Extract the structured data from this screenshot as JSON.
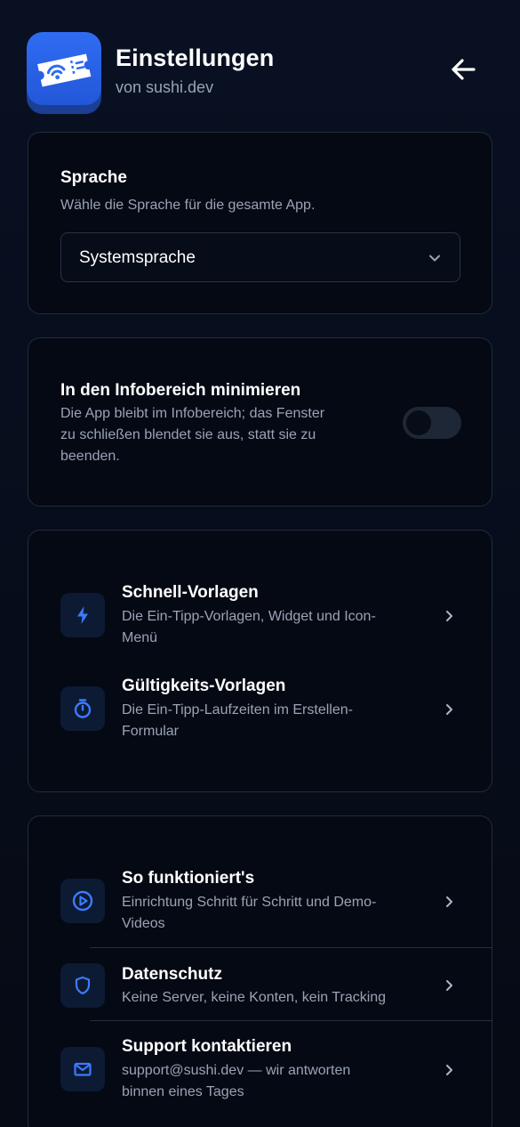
{
  "header": {
    "title": "Einstellungen",
    "subtitle": "von sushi.dev",
    "back_icon": "arrow-left-icon",
    "app_icon": "ticket-wifi-icon"
  },
  "language": {
    "label": "Sprache",
    "description": "Wähle die Sprache für die gesamte App.",
    "selected": "Systemsprache"
  },
  "tray": {
    "label": "In den Infobereich minimieren",
    "description_lines": [
      "Die App bleibt im Infobereich; das Fenster",
      "zu schließen blendet sie aus, statt sie zu",
      "beenden."
    ],
    "enabled": false
  },
  "templates": [
    {
      "icon": "bolt-icon",
      "title": "Schnell-Vorlagen",
      "description_lines": [
        "Die Ein-Tipp-Vorlagen, Widget und Icon-",
        "Menü"
      ]
    },
    {
      "icon": "stopwatch-icon",
      "title": "Gültigkeits-Vorlagen",
      "description_lines": [
        "Die Ein-Tipp-Laufzeiten im Erstellen-",
        "Formular"
      ]
    }
  ],
  "info": [
    {
      "icon": "play-circle-icon",
      "title": "So funktioniert's",
      "description_lines": [
        "Einrichtung Schritt für Schritt und Demo-",
        "Videos"
      ]
    },
    {
      "icon": "shield-icon",
      "title": "Datenschutz",
      "description_lines": [
        "Keine Server, keine Konten, kein Tracking"
      ]
    },
    {
      "icon": "mail-icon",
      "title": "Support kontaktieren",
      "description_lines": [
        "support@sushi.dev — wir antworten",
        "binnen eines Tages"
      ]
    }
  ],
  "colors": {
    "accent": "#3b7bff",
    "background": "#060b16",
    "card_border": "#232b3b",
    "muted_text": "#9aa3b5"
  }
}
